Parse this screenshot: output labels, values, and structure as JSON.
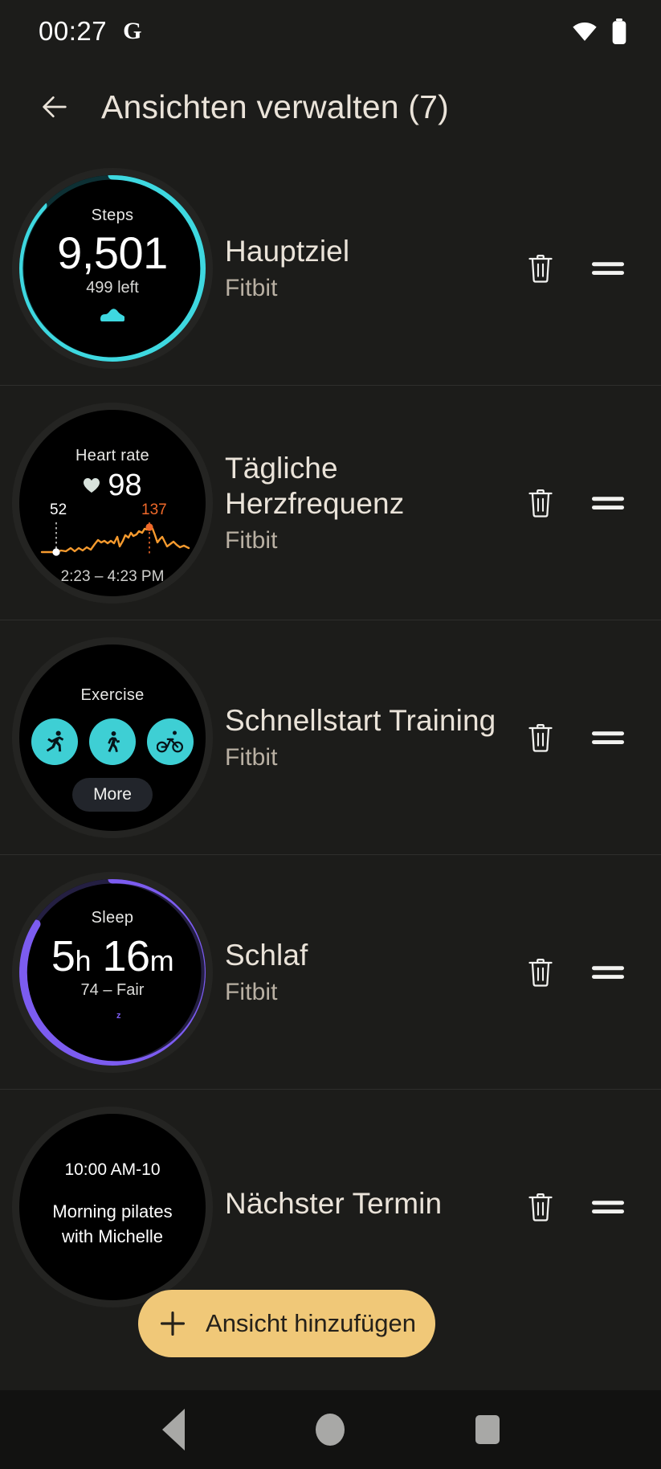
{
  "status_bar": {
    "time": "00:27",
    "app_glyph": "G",
    "wifi_icon": "wifi-icon",
    "battery_icon": "battery-icon"
  },
  "app_bar": {
    "back_icon": "back-arrow-icon",
    "title": "Ansichten verwalten (7)"
  },
  "rows": [
    {
      "title": "Hauptziel",
      "subtitle": "Fitbit",
      "delete_icon": "trash-icon",
      "drag_icon": "drag-handle-icon",
      "preview": {
        "kind": "steps",
        "label": "Steps",
        "value": "9,501",
        "sub": "499 left",
        "icon": "shoe-icon",
        "ring_color": "#3ed8e0",
        "ring_progress": 0.95
      }
    },
    {
      "title": "Tägliche Herzfrequenz",
      "subtitle": "Fitbit",
      "delete_icon": "trash-icon",
      "drag_icon": "drag-handle-icon",
      "preview": {
        "kind": "heart-rate",
        "label": "Heart rate",
        "value": "98",
        "heart_icon": "heart-icon",
        "min": "52",
        "max": "137",
        "time_range": "2:23 – 4:23 PM",
        "line_color": "#f59a2e",
        "max_color": "#f0692a"
      }
    },
    {
      "title": "Schnellstart Training",
      "subtitle": "Fitbit",
      "delete_icon": "trash-icon",
      "drag_icon": "drag-handle-icon",
      "preview": {
        "kind": "exercise",
        "label": "Exercise",
        "more_label": "More",
        "icons": [
          "run-icon",
          "walk-icon",
          "bike-icon"
        ],
        "accent_color": "#3ecfd4"
      }
    },
    {
      "title": "Schlaf",
      "subtitle": "Fitbit",
      "delete_icon": "trash-icon",
      "drag_icon": "drag-handle-icon",
      "preview": {
        "kind": "sleep",
        "label": "Sleep",
        "hours": "5",
        "hours_unit": "h",
        "minutes": "16",
        "minutes_unit": "m",
        "sub": "74 – Fair",
        "icon": "moon-z-icon",
        "ring_color": "#7c5cf0",
        "ring_progress": 0.9
      }
    },
    {
      "title": "Nächster Termin",
      "subtitle": "",
      "delete_icon": "trash-icon",
      "drag_icon": "drag-handle-icon",
      "preview": {
        "kind": "calendar",
        "time": "10:00 AM-10",
        "event": "Morning pilates",
        "event2": "with Michelle"
      }
    }
  ],
  "fab": {
    "plus_icon": "plus-icon",
    "label": "Ansicht hinzufügen",
    "color": "#f0c878"
  },
  "nav_bar": {
    "back_icon": "nav-back-icon",
    "home_icon": "nav-home-icon",
    "recents_icon": "nav-recents-icon"
  }
}
